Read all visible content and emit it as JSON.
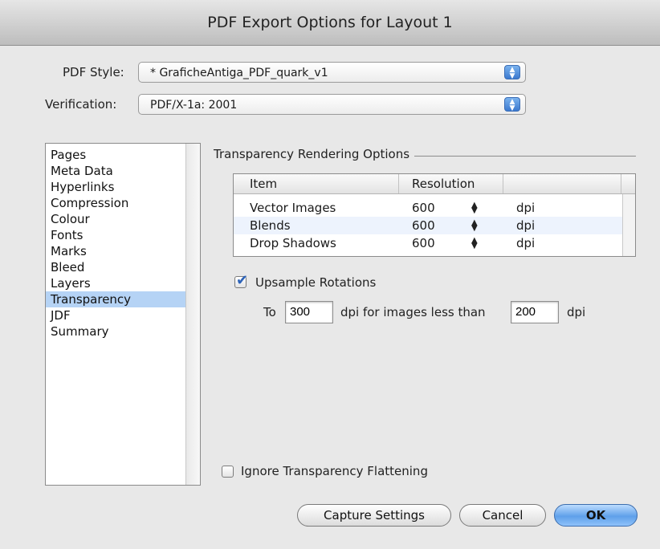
{
  "window": {
    "title": "PDF Export Options for Layout 1"
  },
  "pdf_style": {
    "label": "PDF Style:",
    "value": "* GraficheAntiga_PDF_quark_v1"
  },
  "verification": {
    "label": "Verification:",
    "value": "PDF/X-1a: 2001"
  },
  "sidebar": {
    "items": [
      {
        "label": "Pages"
      },
      {
        "label": "Meta Data"
      },
      {
        "label": "Hyperlinks"
      },
      {
        "label": "Compression"
      },
      {
        "label": "Colour"
      },
      {
        "label": "Fonts"
      },
      {
        "label": "Marks"
      },
      {
        "label": "Bleed"
      },
      {
        "label": "Layers"
      },
      {
        "label": "Transparency",
        "selected": true
      },
      {
        "label": "JDF"
      },
      {
        "label": "Summary"
      }
    ]
  },
  "transparency": {
    "section_title": "Transparency Rendering Options",
    "table": {
      "headers": [
        "Item",
        "Resolution"
      ],
      "rows": [
        {
          "item": "Vector Images",
          "resolution": "600",
          "unit": "dpi"
        },
        {
          "item": "Blends",
          "resolution": "600",
          "unit": "dpi"
        },
        {
          "item": "Drop Shadows",
          "resolution": "600",
          "unit": "dpi"
        }
      ]
    },
    "upsample": {
      "label": "Upsample Rotations",
      "checked": true,
      "to_label": "To",
      "to_value": "300",
      "mid_label": "dpi for images less than",
      "less_than_value": "200",
      "unit": "dpi"
    },
    "ignore_flattening": {
      "label": "Ignore Transparency Flattening",
      "checked": false
    }
  },
  "buttons": {
    "capture_settings": "Capture Settings",
    "cancel": "Cancel",
    "ok": "OK"
  },
  "colors": {
    "selection": "#b5d3f5",
    "default_button": "#5fa0ea"
  }
}
